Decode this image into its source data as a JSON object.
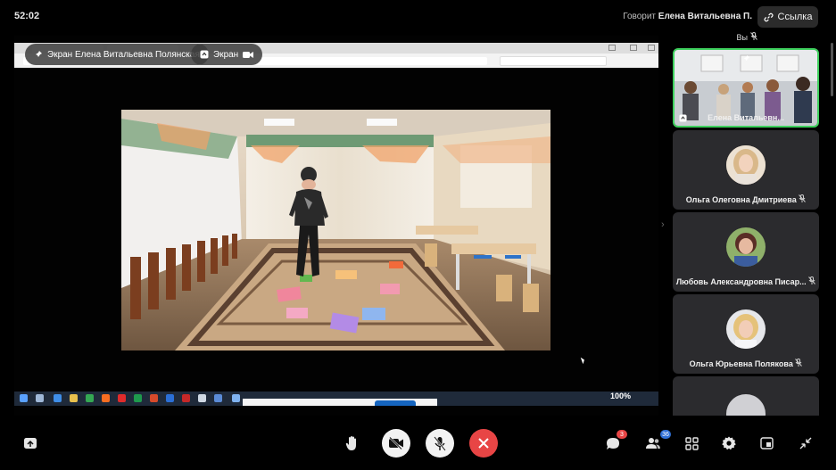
{
  "header": {
    "timer": "52:02",
    "speaker_prefix": "Говорит",
    "speaker_name": "Елена Витальевна П.",
    "link_label": "Ссылка"
  },
  "screen_share": {
    "pill_presenter": "Экран Елена Витальевна Полянская",
    "pill_screen": "Экран",
    "taskbar_zoom": "100%"
  },
  "participants": {
    "self_label": "Вы",
    "tiles": [
      {
        "name": "Елена Витальевн...",
        "active": true
      },
      {
        "name": "Ольга Олеговна Дмитриева"
      },
      {
        "name": "Любовь Александровна Писар..."
      },
      {
        "name": "Ольга Юрьевна Полякова"
      }
    ]
  },
  "controls": {
    "chat_badge": "3",
    "participants_badge": "36"
  },
  "colors": {
    "active_border": "#3fd15e",
    "hangup": "#e84545",
    "badge": "#2f6fd6"
  }
}
